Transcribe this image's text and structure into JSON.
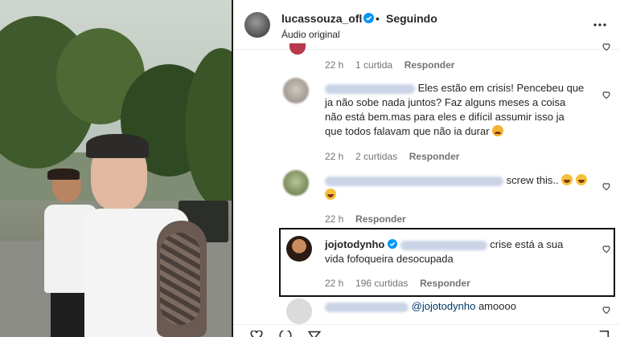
{
  "post": {
    "author": "lucassouza_ofl",
    "separator": "•",
    "follow_status": "Seguindo",
    "audio": "Áudio original"
  },
  "comments": [
    {
      "time": "22 h",
      "likes": "1 curtida",
      "reply": "Responder"
    },
    {
      "text_line1": "Eles estão em crisis! Pencebeu que",
      "text_line2": "ja não sobe nada juntos? Faz alguns meses a coisa",
      "text_line3": "não está bem.mas para eles e difícil assumir isso ja",
      "text_line4": "que todos falavam que não ia durar",
      "time": "22 h",
      "likes": "2 curtidas",
      "reply": "Responder"
    },
    {
      "text": "screw this..",
      "time": "22 h",
      "reply": "Responder"
    },
    {
      "username": "jojotodynho",
      "text_line1": "crise está a sua",
      "text_line2": "vida fofoqueira desocupada",
      "time": "22 h",
      "likes": "196 curtidas",
      "reply": "Responder"
    },
    {
      "mention": "@jojotodynho",
      "text": "amoooo"
    }
  ],
  "icons": {
    "verified": "verified-badge-icon",
    "more": "more-options-icon",
    "heart": "heart-icon",
    "accent": "#0095f6"
  }
}
